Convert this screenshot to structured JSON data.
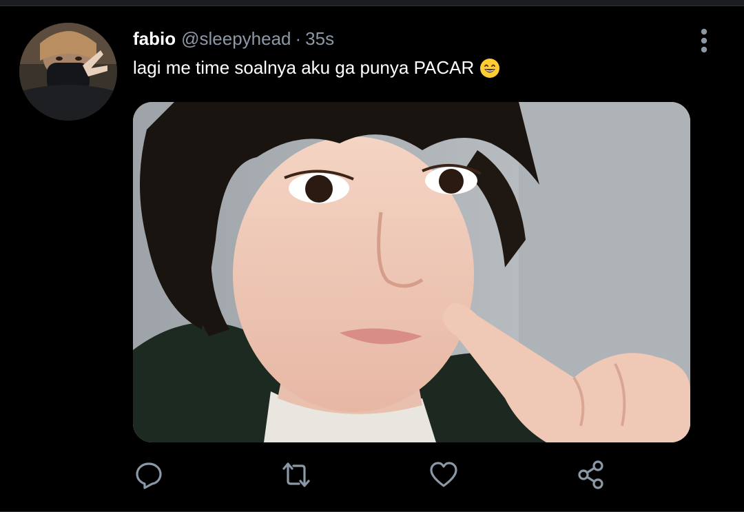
{
  "tweet": {
    "display_name": "fabio",
    "handle": "@sleepyhead",
    "separator": "·",
    "timestamp": "35s",
    "text": "lagi me time soalnya aku ga punya PACAR",
    "emoji": "grinning-face-with-smiling-eyes"
  },
  "icons": {
    "more": "more-vertical-icon",
    "reply": "reply-icon",
    "retweet": "retweet-icon",
    "like": "heart-icon",
    "share": "share-icon"
  },
  "colors": {
    "background": "#000000",
    "text": "#ffffff",
    "secondary": "#8b98a5",
    "icon": "#8b98a5"
  }
}
